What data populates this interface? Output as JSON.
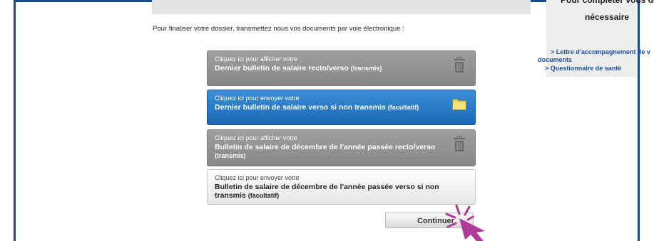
{
  "side_panel": {
    "heading_line1": "Pour compléter vous de",
    "heading_line2": "nécessaire",
    "link_1a": "> Lettre d'accompagnement de v",
    "link_1b": "documents",
    "link_2": "> Questionnaire de santé"
  },
  "intro_text": "Pour finaliser votre dossier, transmettez nous vos documents par voie électronique :",
  "documents": [
    {
      "action": "Cliquez ici pour afficher votre",
      "title": "Dernier bulletin de salaire recto/verso",
      "suffix": "(transmis)",
      "icon": "trash-icon"
    },
    {
      "action": "Cliquez ici pour envoyer votre",
      "title": "Dernier bulletin de salaire verso si non transmis",
      "suffix": "(facultatif)",
      "icon": "folder-icon"
    },
    {
      "action": "Cliquez ici pour afficher votre",
      "title": "Bulletin de salaire de décembre de l'année passée recto/verso",
      "suffix": "(transmis)",
      "icon": "trash-icon"
    },
    {
      "action": "Cliquez ici pour envoyer votre",
      "title": "Bulletin de salaire de décembre de l'année passée verso si non transmis",
      "suffix": "(facultatif)",
      "icon": "none"
    }
  ],
  "continue_label": "Continuer",
  "colors": {
    "frame": "#1a4a8a",
    "accent_blue": "#1c68b5",
    "cursor_magenta": "#b03a9a",
    "link": "#1f4f9f"
  }
}
